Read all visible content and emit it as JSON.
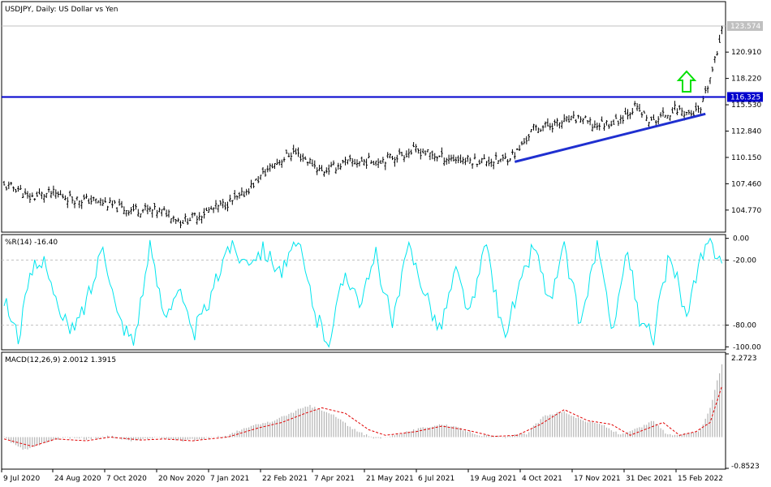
{
  "chart_data": [
    {
      "type": "bar",
      "style": "ohlc",
      "title": "USDJPY, Daily:  US Dollar vs Yen",
      "y_ticks": [
        "123.574",
        "120.910",
        "118.220",
        "116.325",
        "115.530",
        "112.840",
        "110.150",
        "107.460",
        "104.770"
      ],
      "current_price_label": "123.574",
      "horizontal_level": 116.325,
      "horizontal_level_label": "116.325",
      "ylim": [
        102.6,
        125.9
      ],
      "x_labels": [
        "9 Jul 2020",
        "24 Aug 2020",
        "7 Oct 2020",
        "20 Nov 2020",
        "7 Jan 2021",
        "22 Feb 2021",
        "7 Apr 2021",
        "21 May 2021",
        "6 Jul 2021",
        "19 Aug 2021",
        "4 Oct 2021",
        "17 Nov 2021",
        "31 Dec 2021",
        "15 Feb 2022"
      ],
      "close_anchors": [
        {
          "i": 0,
          "v": 107.2
        },
        {
          "i": 6,
          "v": 107.0
        },
        {
          "i": 10,
          "v": 106.0
        },
        {
          "i": 20,
          "v": 106.5
        },
        {
          "i": 30,
          "v": 105.9
        },
        {
          "i": 40,
          "v": 105.7
        },
        {
          "i": 50,
          "v": 104.9
        },
        {
          "i": 60,
          "v": 104.8
        },
        {
          "i": 70,
          "v": 104.5
        },
        {
          "i": 75,
          "v": 103.6
        },
        {
          "i": 80,
          "v": 104.0
        },
        {
          "i": 90,
          "v": 105.0
        },
        {
          "i": 100,
          "v": 106.0
        },
        {
          "i": 110,
          "v": 108.4
        },
        {
          "i": 115,
          "v": 109.5
        },
        {
          "i": 123,
          "v": 110.7
        },
        {
          "i": 130,
          "v": 109.7
        },
        {
          "i": 135,
          "v": 108.7
        },
        {
          "i": 145,
          "v": 109.6
        },
        {
          "i": 160,
          "v": 109.9
        },
        {
          "i": 170,
          "v": 110.5
        },
        {
          "i": 175,
          "v": 110.9
        },
        {
          "i": 185,
          "v": 110.2
        },
        {
          "i": 195,
          "v": 109.9
        },
        {
          "i": 205,
          "v": 109.8
        },
        {
          "i": 212,
          "v": 109.9
        },
        {
          "i": 218,
          "v": 110.7
        },
        {
          "i": 225,
          "v": 113.1
        },
        {
          "i": 235,
          "v": 113.6
        },
        {
          "i": 245,
          "v": 114.2
        },
        {
          "i": 250,
          "v": 113.4
        },
        {
          "i": 260,
          "v": 113.8
        },
        {
          "i": 268,
          "v": 115.3
        },
        {
          "i": 275,
          "v": 113.7
        },
        {
          "i": 285,
          "v": 115.1
        },
        {
          "i": 292,
          "v": 114.6
        },
        {
          "i": 296,
          "v": 114.9
        },
        {
          "i": 300,
          "v": 118.2
        },
        {
          "i": 303,
          "v": 120.8
        },
        {
          "i": 305,
          "v": 123.6
        }
      ],
      "trendline": {
        "from": {
          "i": 217,
          "v": 109.7
        },
        "to": {
          "i": 298,
          "v": 114.6
        }
      },
      "annotation": "up-arrow"
    },
    {
      "type": "line",
      "title": "%R(14) -16.40",
      "y_ticks": [
        "0.00",
        "-20.00",
        "-80.00",
        "-100.00"
      ],
      "levels": [
        -20,
        -80
      ],
      "ylim": [
        -102,
        2
      ],
      "color": "#00e5ee",
      "anchors": [
        {
          "i": 0,
          "v": -55
        },
        {
          "i": 6,
          "v": -90
        },
        {
          "i": 12,
          "v": -30
        },
        {
          "i": 18,
          "v": -20
        },
        {
          "i": 24,
          "v": -75
        },
        {
          "i": 30,
          "v": -85
        },
        {
          "i": 38,
          "v": -40
        },
        {
          "i": 42,
          "v": -2
        },
        {
          "i": 48,
          "v": -70
        },
        {
          "i": 55,
          "v": -95
        },
        {
          "i": 62,
          "v": -10
        },
        {
          "i": 68,
          "v": -70
        },
        {
          "i": 74,
          "v": -45
        },
        {
          "i": 80,
          "v": -90
        },
        {
          "i": 88,
          "v": -55
        },
        {
          "i": 95,
          "v": -5
        },
        {
          "i": 102,
          "v": -20
        },
        {
          "i": 110,
          "v": -10
        },
        {
          "i": 118,
          "v": -30
        },
        {
          "i": 125,
          "v": -5
        },
        {
          "i": 133,
          "v": -75
        },
        {
          "i": 138,
          "v": -95
        },
        {
          "i": 145,
          "v": -30
        },
        {
          "i": 152,
          "v": -60
        },
        {
          "i": 158,
          "v": -15
        },
        {
          "i": 165,
          "v": -80
        },
        {
          "i": 172,
          "v": -8
        },
        {
          "i": 180,
          "v": -55
        },
        {
          "i": 185,
          "v": -85
        },
        {
          "i": 192,
          "v": -30
        },
        {
          "i": 198,
          "v": -70
        },
        {
          "i": 205,
          "v": -5
        },
        {
          "i": 212,
          "v": -90
        },
        {
          "i": 220,
          "v": -40
        },
        {
          "i": 225,
          "v": -5
        },
        {
          "i": 232,
          "v": -60
        },
        {
          "i": 238,
          "v": -10
        },
        {
          "i": 245,
          "v": -80
        },
        {
          "i": 252,
          "v": -5
        },
        {
          "i": 258,
          "v": -85
        },
        {
          "i": 265,
          "v": -10
        },
        {
          "i": 270,
          "v": -80
        },
        {
          "i": 276,
          "v": -90
        },
        {
          "i": 283,
          "v": -10
        },
        {
          "i": 290,
          "v": -75
        },
        {
          "i": 296,
          "v": -20
        },
        {
          "i": 300,
          "v": -5
        },
        {
          "i": 305,
          "v": -16.4
        }
      ]
    },
    {
      "type": "bar",
      "title": "MACD(12,26,9) 2.0012 1.3915",
      "y_ticks": [
        "2.2723",
        "-0.8523"
      ],
      "ylim": [
        -0.8523,
        2.2723
      ],
      "macd": 2.0012,
      "signal": 1.3915,
      "hist_anchors": [
        {
          "i": 0,
          "v": 0.0
        },
        {
          "i": 8,
          "v": -0.35
        },
        {
          "i": 15,
          "v": -0.2
        },
        {
          "i": 25,
          "v": 0.0
        },
        {
          "i": 35,
          "v": -0.05
        },
        {
          "i": 45,
          "v": 0.02
        },
        {
          "i": 55,
          "v": -0.1
        },
        {
          "i": 65,
          "v": 0.0
        },
        {
          "i": 75,
          "v": -0.1
        },
        {
          "i": 85,
          "v": -0.05
        },
        {
          "i": 95,
          "v": 0.05
        },
        {
          "i": 105,
          "v": 0.3
        },
        {
          "i": 115,
          "v": 0.45
        },
        {
          "i": 125,
          "v": 0.75
        },
        {
          "i": 130,
          "v": 0.85
        },
        {
          "i": 140,
          "v": 0.6
        },
        {
          "i": 150,
          "v": 0.15
        },
        {
          "i": 158,
          "v": -0.05
        },
        {
          "i": 168,
          "v": 0.1
        },
        {
          "i": 178,
          "v": 0.25
        },
        {
          "i": 185,
          "v": 0.35
        },
        {
          "i": 193,
          "v": 0.25
        },
        {
          "i": 203,
          "v": 0.05
        },
        {
          "i": 213,
          "v": 0.0
        },
        {
          "i": 222,
          "v": 0.1
        },
        {
          "i": 230,
          "v": 0.6
        },
        {
          "i": 238,
          "v": 0.7
        },
        {
          "i": 246,
          "v": 0.45
        },
        {
          "i": 254,
          "v": 0.35
        },
        {
          "i": 262,
          "v": 0.05
        },
        {
          "i": 270,
          "v": 0.25
        },
        {
          "i": 276,
          "v": 0.45
        },
        {
          "i": 282,
          "v": 0.05
        },
        {
          "i": 290,
          "v": 0.1
        },
        {
          "i": 296,
          "v": 0.2
        },
        {
          "i": 300,
          "v": 0.8
        },
        {
          "i": 305,
          "v": 2.0
        }
      ],
      "signal_anchors": [
        {
          "i": 0,
          "v": -0.05
        },
        {
          "i": 12,
          "v": -0.25
        },
        {
          "i": 22,
          "v": -0.05
        },
        {
          "i": 35,
          "v": -0.1
        },
        {
          "i": 45,
          "v": 0.0
        },
        {
          "i": 58,
          "v": -0.08
        },
        {
          "i": 68,
          "v": -0.05
        },
        {
          "i": 80,
          "v": -0.1
        },
        {
          "i": 95,
          "v": 0.0
        },
        {
          "i": 108,
          "v": 0.25
        },
        {
          "i": 118,
          "v": 0.4
        },
        {
          "i": 128,
          "v": 0.65
        },
        {
          "i": 135,
          "v": 0.8
        },
        {
          "i": 145,
          "v": 0.65
        },
        {
          "i": 155,
          "v": 0.2
        },
        {
          "i": 162,
          "v": 0.05
        },
        {
          "i": 175,
          "v": 0.15
        },
        {
          "i": 186,
          "v": 0.3
        },
        {
          "i": 196,
          "v": 0.2
        },
        {
          "i": 208,
          "v": 0.02
        },
        {
          "i": 218,
          "v": 0.05
        },
        {
          "i": 228,
          "v": 0.35
        },
        {
          "i": 238,
          "v": 0.75
        },
        {
          "i": 248,
          "v": 0.45
        },
        {
          "i": 258,
          "v": 0.35
        },
        {
          "i": 266,
          "v": 0.05
        },
        {
          "i": 274,
          "v": 0.25
        },
        {
          "i": 280,
          "v": 0.4
        },
        {
          "i": 287,
          "v": 0.05
        },
        {
          "i": 294,
          "v": 0.15
        },
        {
          "i": 300,
          "v": 0.4
        },
        {
          "i": 305,
          "v": 1.39
        }
      ]
    }
  ],
  "colors": {
    "price_bars": "#000000",
    "horizontal_line": "#0000cd",
    "trendline": "#1f2fd0",
    "arrow": "#00e000",
    "wpr_line": "#00e5ee",
    "macd_hist": "#b4b4b4",
    "signal_line": "#e00000",
    "grid": "#c0c0c0",
    "level_tag_bg": "#0000cd",
    "price_tag_bg": "#c0c0c0"
  }
}
